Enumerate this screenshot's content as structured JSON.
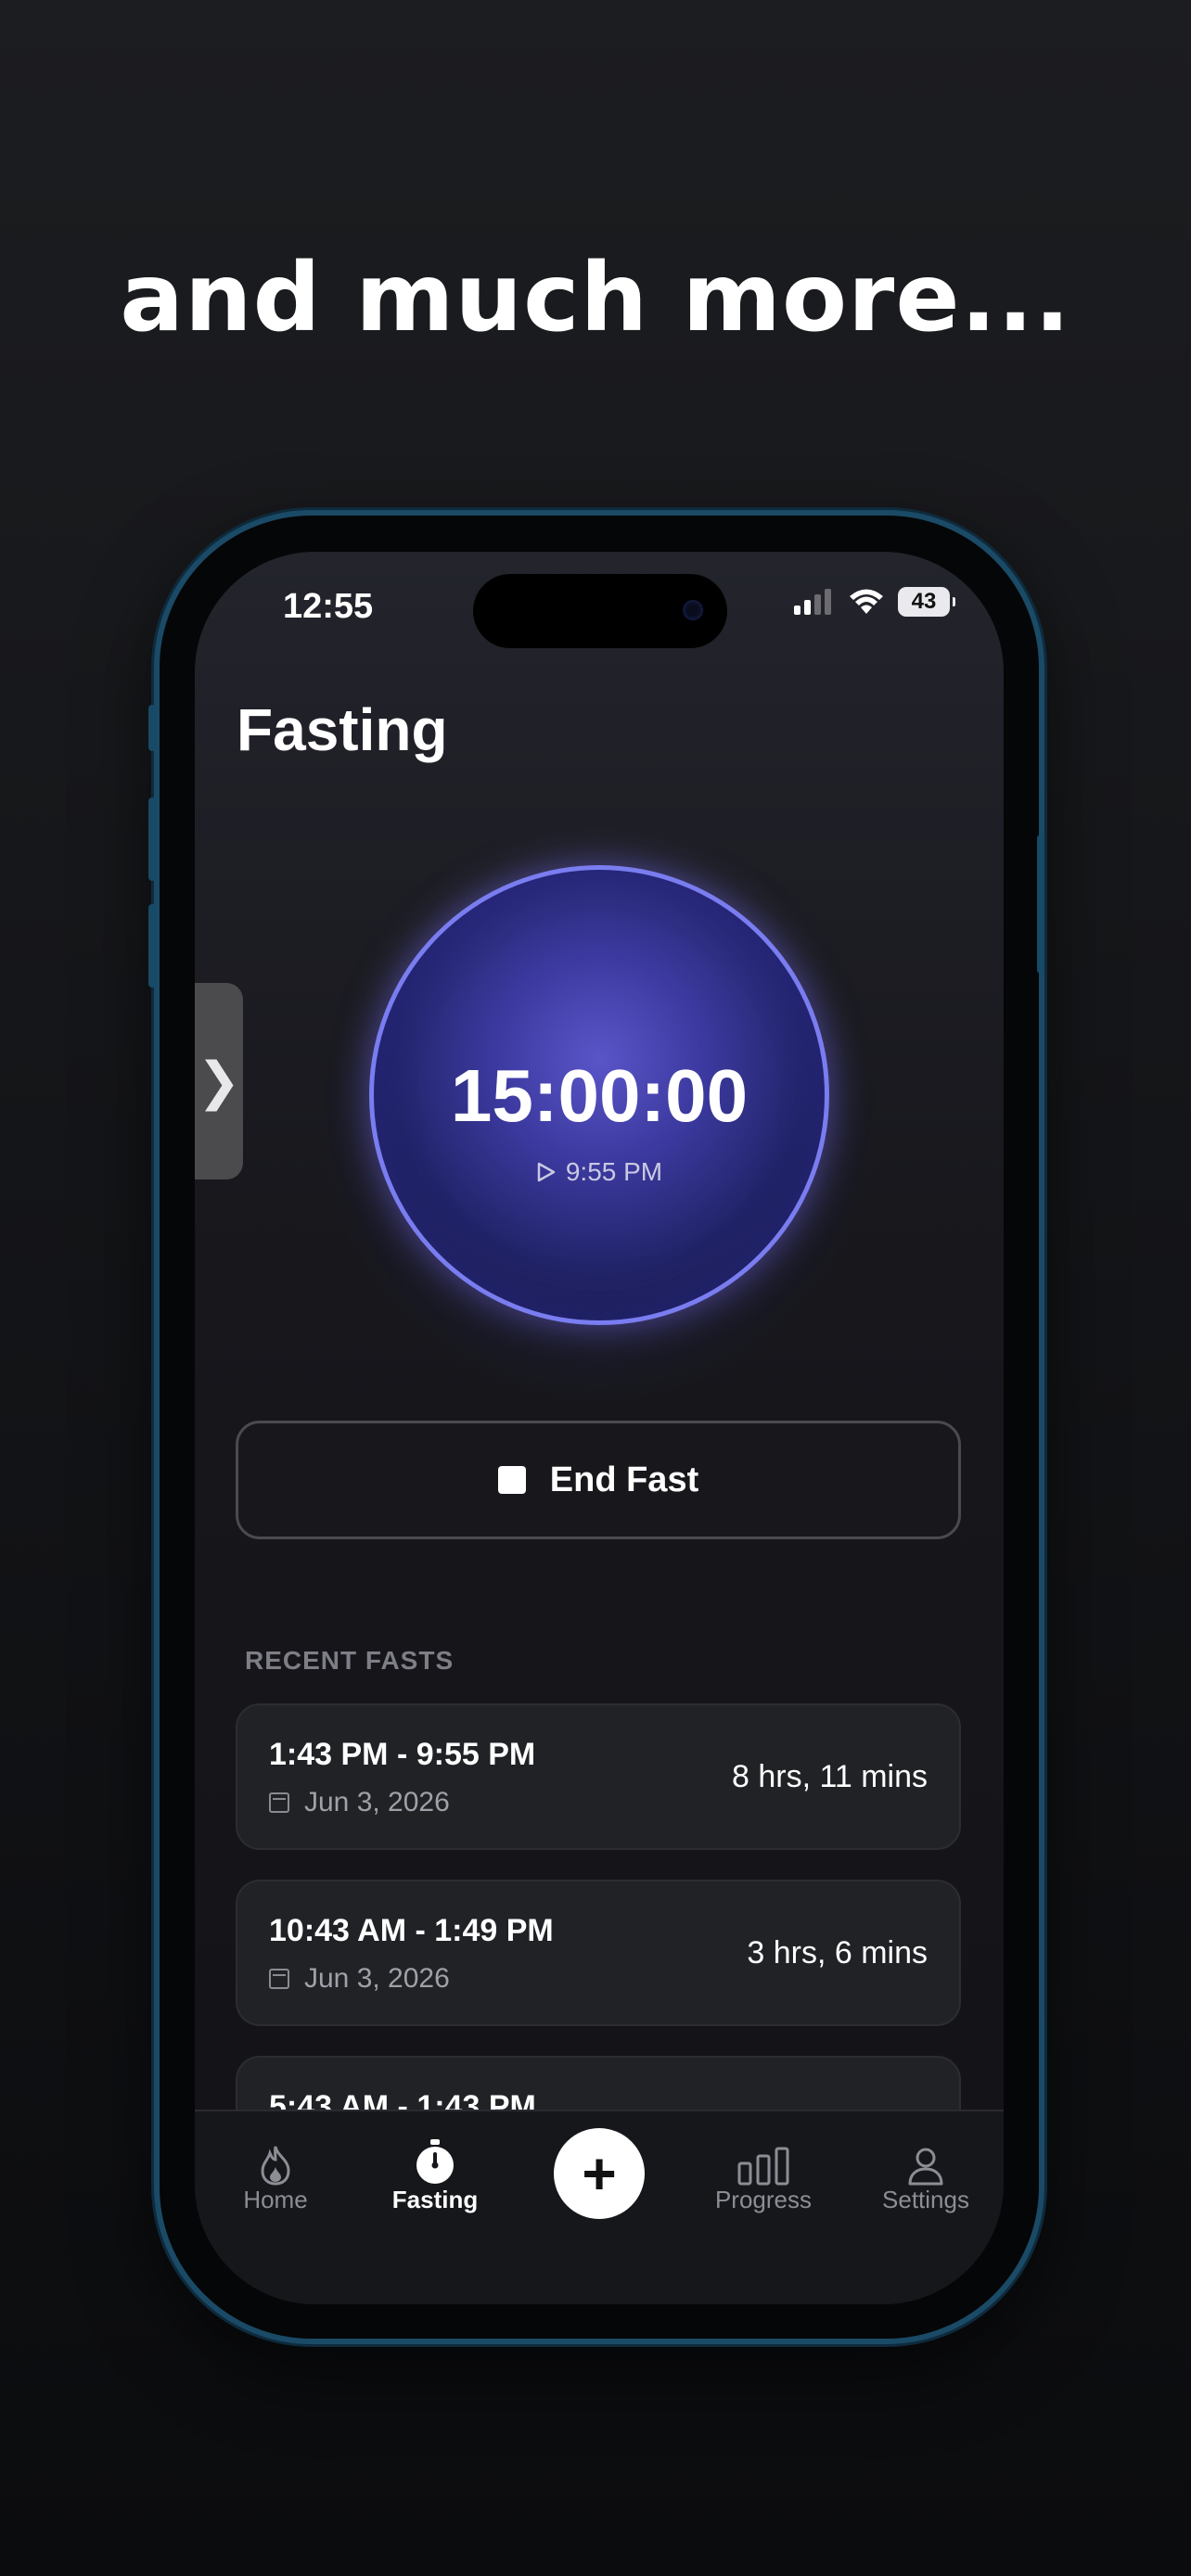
{
  "headline": "and much more...",
  "status_bar": {
    "time": "12:55",
    "battery": "43",
    "icons": [
      "cellular-signal-icon",
      "wifi-icon",
      "battery-icon"
    ]
  },
  "screen": {
    "title": "Fasting"
  },
  "timer": {
    "value": "15:00:00",
    "start_time": "9:55 PM",
    "start_icon": "play-icon"
  },
  "end_button": {
    "label": "End Fast",
    "icon": "stop-icon"
  },
  "recent": {
    "label": "RECENT FASTS",
    "items": [
      {
        "range": "1:43 PM - 9:55 PM",
        "date": "Jun 3, 2026",
        "duration": "8 hrs, 11 mins"
      },
      {
        "range": "10:43 AM - 1:49 PM",
        "date": "Jun 3, 2026",
        "duration": "3 hrs, 6 mins"
      },
      {
        "range": "5:43 AM - 1:43 PM",
        "date": "",
        "duration": ""
      }
    ]
  },
  "tabbar": {
    "items": [
      {
        "label": "Home",
        "icon": "flame-icon",
        "active": false
      },
      {
        "label": "Fasting",
        "icon": "stopwatch-icon",
        "active": true
      },
      {
        "label": "Progress",
        "icon": "bar-chart-icon",
        "active": false
      },
      {
        "label": "Settings",
        "icon": "person-icon",
        "active": false
      }
    ],
    "add_icon": "plus-icon"
  },
  "colors": {
    "accent_ring": "#7a7df0",
    "background": "#131317",
    "card": "#202226"
  }
}
